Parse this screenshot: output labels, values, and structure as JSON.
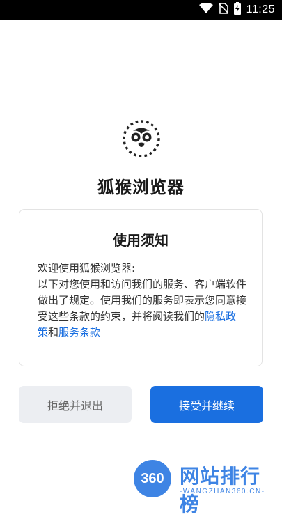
{
  "status_bar": {
    "time": "11:25",
    "icons": [
      "wifi-icon",
      "no-sim-icon",
      "battery-charging-icon"
    ]
  },
  "app": {
    "name": "狐猴浏览器",
    "logo_icon": "lemur-logo-icon"
  },
  "notice": {
    "title": "使用须知",
    "line1": "欢迎使用狐猴浏览器:",
    "text_before": "以下对您使用和访问我们的服务、客户端软件做出了规定。使用我们的服务即表示您同意接受这些条款的约束，并将阅读我们的",
    "privacy_link": "隐私政策",
    "and": "和",
    "terms_link": "服务条款"
  },
  "buttons": {
    "reject_label": "拒绝并退出",
    "accept_label": "接受并继续"
  },
  "watermark": {
    "badge": "360",
    "title": "网站排行榜",
    "subtitle": "-WANGZHAN360.CN-"
  },
  "colors": {
    "accent": "#1a6fe0",
    "reject_bg": "#eceef2",
    "text": "#1a1a1a"
  }
}
